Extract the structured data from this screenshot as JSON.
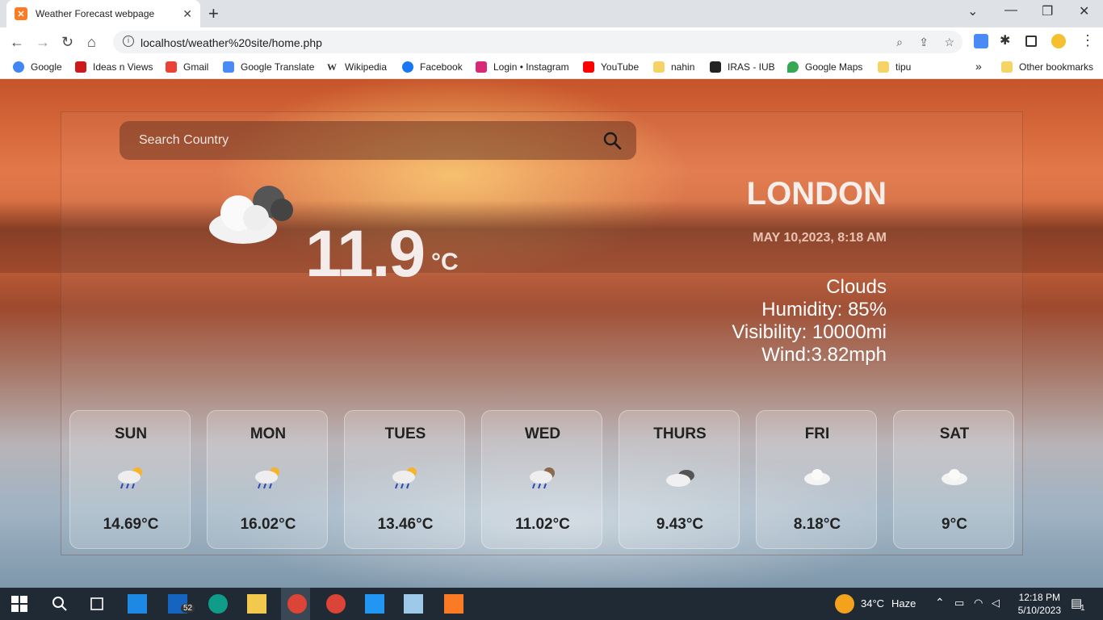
{
  "browser": {
    "tab_title": "Weather Forecast webpage",
    "url": "localhost/weather%20site/home.php",
    "bookmarks": [
      {
        "label": "Google",
        "color": "#4285f4"
      },
      {
        "label": "Ideas n Views",
        "color": "#cc1a1a"
      },
      {
        "label": "Gmail",
        "color": "#ea4335"
      },
      {
        "label": "Google Translate",
        "color": "#4a8af4"
      },
      {
        "label": "Wikipedia",
        "color": "#333333"
      },
      {
        "label": "Facebook",
        "color": "#1877f2"
      },
      {
        "label": "Login • Instagram",
        "color": "#d62976"
      },
      {
        "label": "YouTube",
        "color": "#ff0000"
      },
      {
        "label": "nahin",
        "color": "#f6d365"
      },
      {
        "label": "IRAS - IUB",
        "color": "#222222"
      },
      {
        "label": "Google Maps",
        "color": "#34a853"
      },
      {
        "label": "tipu",
        "color": "#f6d365"
      }
    ],
    "more_bookmarks": "»",
    "other_bookmarks": "Other bookmarks"
  },
  "search": {
    "placeholder": "Search Country"
  },
  "current": {
    "temperature": "11.9",
    "unit": "°C",
    "city": "LONDON",
    "datetime": "MAY 10,2023, 8:18 AM",
    "condition": "Clouds",
    "humidity": "Humidity: 85%",
    "visibility": "Visibility: 10000mi",
    "wind": "Wind:3.82mph",
    "icon": "cloud-icon"
  },
  "forecast": [
    {
      "day": "SUN",
      "temp": "14.69°C",
      "icon": "rain-sun-icon"
    },
    {
      "day": "MON",
      "temp": "16.02°C",
      "icon": "rain-sun-icon"
    },
    {
      "day": "TUES",
      "temp": "13.46°C",
      "icon": "rain-sun-icon"
    },
    {
      "day": "WED",
      "temp": "11.02°C",
      "icon": "rain-cloud-icon"
    },
    {
      "day": "THURS",
      "temp": "9.43°C",
      "icon": "cloud-dark-icon"
    },
    {
      "day": "FRI",
      "temp": "8.18°C",
      "icon": "cloud-icon"
    },
    {
      "day": "SAT",
      "temp": "9°C",
      "icon": "cloud-icon"
    }
  ],
  "taskbar": {
    "mail_badge": "52",
    "weather": "34°C",
    "weather_label": "Haze",
    "time": "12:18 PM",
    "date": "5/10/2023",
    "notifications": "1"
  }
}
